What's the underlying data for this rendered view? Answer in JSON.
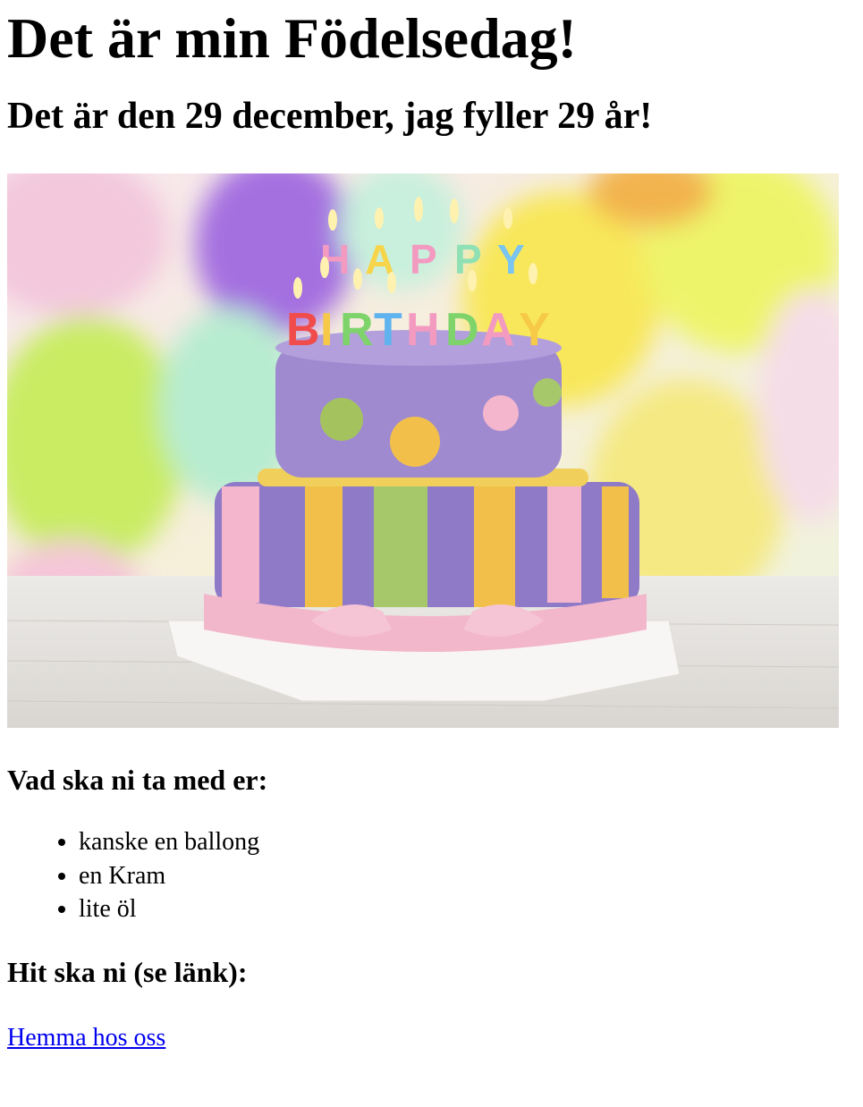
{
  "page": {
    "title": "Det är min Födelsedag!",
    "subtitle": "Det är den 29 december, jag fyller 29 år!",
    "image": {
      "subject": "birthday-cake",
      "candle_text": "HAPPY BIRTHDAY"
    },
    "bring_heading": "Vad ska ni ta med er:",
    "bring_items": [
      "kanske en ballong",
      "en Kram",
      "lite öl"
    ],
    "where_heading": "Hit ska ni (se länk):",
    "link_label": "Hemma hos oss"
  },
  "colors": {
    "text": "#000000",
    "link": "#0000ee",
    "background": "#ffffff",
    "cake_top": "#9f8ad0",
    "cake_bottom": "#8f7ac8",
    "ribbon_pink": "#f4b6cc",
    "stripe_yellow": "#f2c04a",
    "stripe_green": "#a7c86a"
  }
}
